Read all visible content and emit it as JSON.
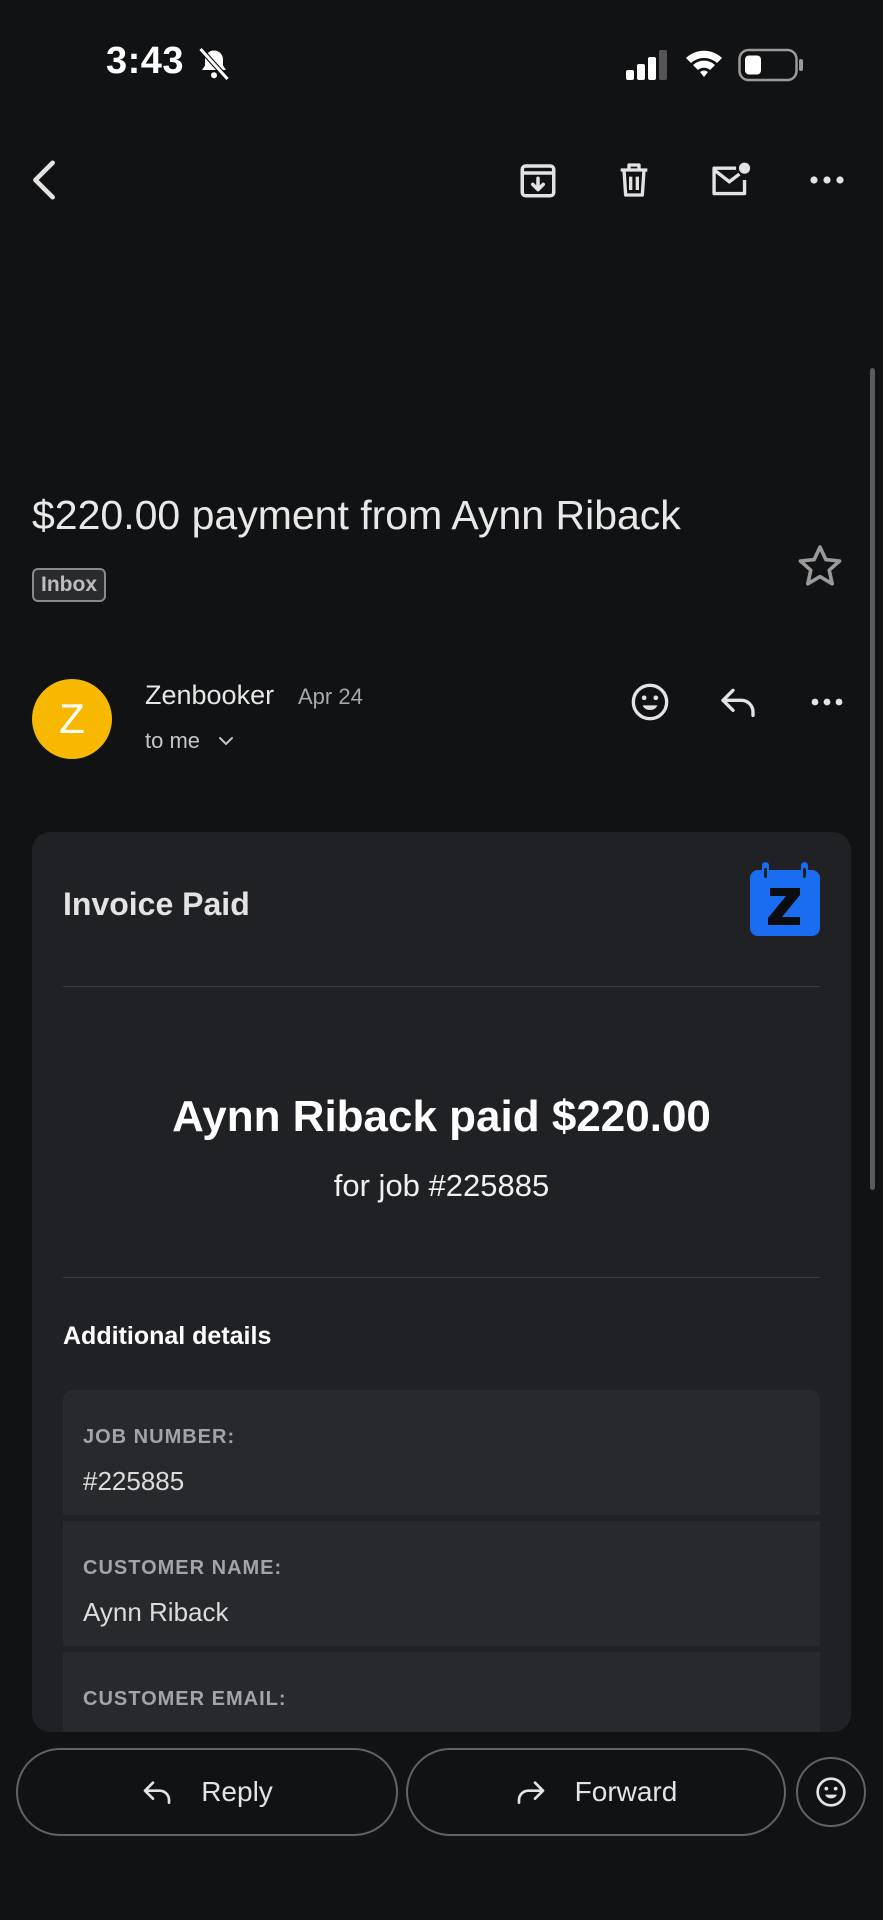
{
  "status_bar": {
    "time": "3:43"
  },
  "toolbar": {
    "icons": [
      "back-icon",
      "archive-icon",
      "delete-icon",
      "mark-unread-icon",
      "more-icon"
    ]
  },
  "email": {
    "subject": "$220.00 payment from Aynn Riback",
    "label": "Inbox",
    "sender": {
      "initial": "Z",
      "name": "Zenbooker",
      "date": "Apr 24",
      "recipient": "to me"
    }
  },
  "card": {
    "title": "Invoice Paid",
    "headline": "Aynn Riback paid $220.00",
    "subline": "for job #225885",
    "details_heading": "Additional details",
    "details": [
      {
        "label": "JOB NUMBER:",
        "value": "#225885"
      },
      {
        "label": "CUSTOMER NAME:",
        "value": "Aynn Riback"
      },
      {
        "label": "CUSTOMER EMAIL:",
        "value": ""
      }
    ]
  },
  "actions": {
    "reply": "Reply",
    "forward": "Forward"
  },
  "colors": {
    "background": "#111214",
    "card": "#202124",
    "avatar": "#f9b800",
    "logo": "#1a6cf0",
    "link": "#8ab4f8"
  }
}
